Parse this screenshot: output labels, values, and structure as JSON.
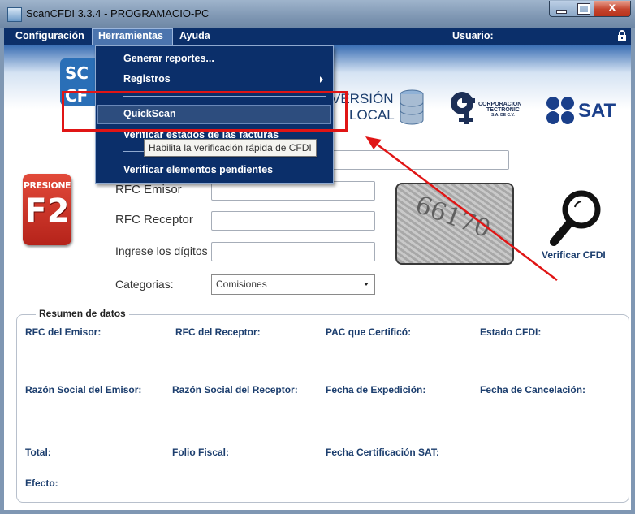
{
  "window": {
    "title": "ScanCFDI 3.3.4 - PROGRAMACIO-PC",
    "close_glyph": "x"
  },
  "menubar": {
    "items": [
      "Configuración",
      "Herramientas",
      "Ayuda"
    ],
    "user_label": "Usuario:"
  },
  "banner": {
    "scan_logo_text": "SC",
    "scan_logo_text2": "CF",
    "version_line1": "VERSIÓN",
    "version_line2": "LOCAL",
    "corp_line1": "CORPORACION",
    "corp_line2": "TECTRONIC",
    "corp_line3": "S.A. DE C.V.",
    "sat_text": "SAT"
  },
  "dropdown": {
    "items": [
      {
        "label": "Generar reportes..."
      },
      {
        "label": "Registros",
        "has_submenu": true
      },
      {
        "label": "QuickScan",
        "hovered": true
      },
      {
        "label": "Verificar estados de las facturas"
      },
      {
        "label": "Verificar elementos pendientes"
      }
    ],
    "tooltip": "Habilita la verificación rápida de CFDI"
  },
  "form": {
    "f2_line1": "PRESIONE",
    "f2_line2": "F2",
    "rfc_emisor_label": "RFC Emisor",
    "rfc_receptor_label": "RFC Receptor",
    "digits_label": "Ingrese los dígitos",
    "categories_label": "Categorias:",
    "categories_value": "Comisiones",
    "captcha_text": "66170",
    "verify_label": "Verificar CFDI"
  },
  "summary": {
    "legend": "Resumen de datos",
    "rfc_emisor": "RFC del Emisor:",
    "rfc_receptor": "RFC del Receptor:",
    "pac": "PAC que Certificó:",
    "estado": "Estado CFDI:",
    "razon_emisor": "Razón Social del Emisor:",
    "razon_receptor": "Razón Social del Receptor:",
    "fecha_exp": "Fecha de Expedición:",
    "fecha_canc": "Fecha de Cancelación:",
    "total": "Total:",
    "folio": "Folio Fiscal:",
    "fecha_cert": "Fecha Certificación SAT:",
    "efecto": "Efecto:"
  },
  "colors": {
    "menubar": "#0b2f6a",
    "highlight": "#e01515",
    "accent_text": "#1c3e6e"
  }
}
